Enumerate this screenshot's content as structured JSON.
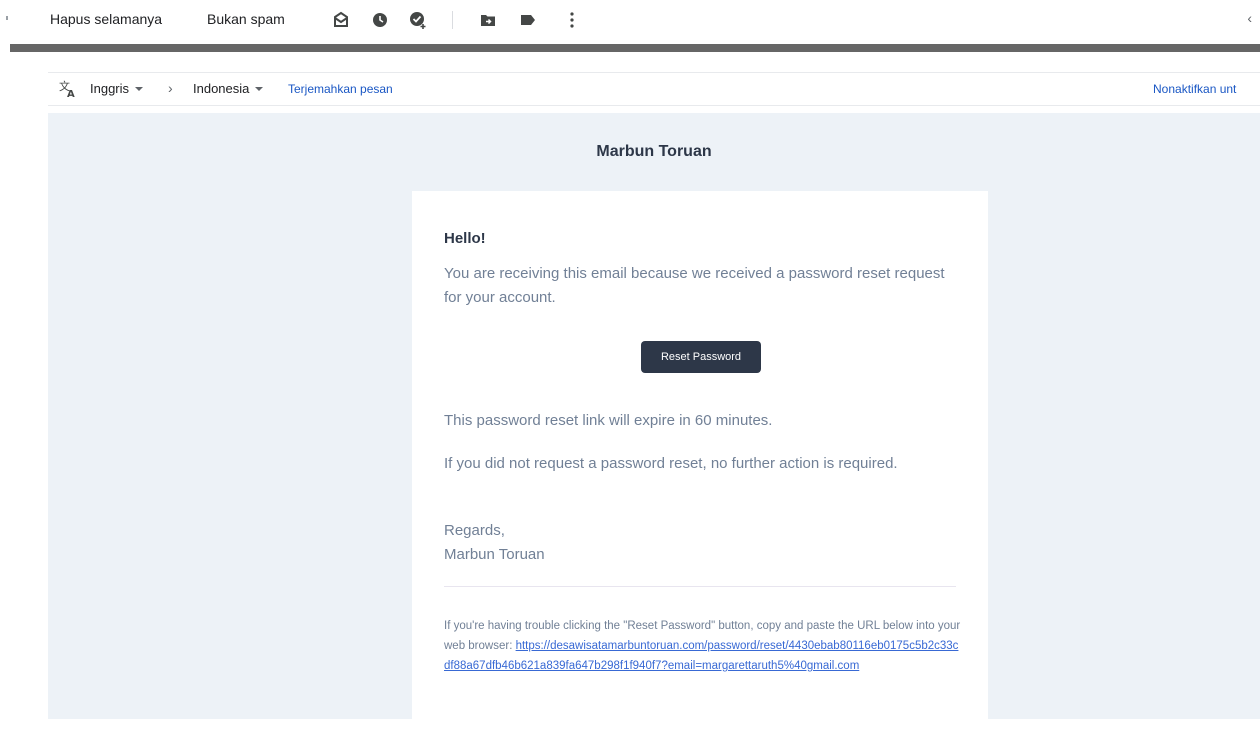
{
  "toolbar": {
    "delete_forever": "Hapus selamanya",
    "not_spam": "Bukan spam",
    "icons": [
      "mark-unread-icon",
      "snooze-icon",
      "add-to-tasks-icon",
      "move-to-icon",
      "label-icon",
      "more-options-icon"
    ]
  },
  "translate": {
    "from_lang": "Inggris",
    "to_lang": "Indonesia",
    "translate_link": "Terjemahkan pesan",
    "disable_link": "Nonaktifkan unt"
  },
  "email": {
    "sender_header": "Marbun Toruan",
    "greeting": "Hello!",
    "intro": "You are receiving this email because we received a password reset request for your account.",
    "button_label": "Reset Password",
    "expire_note": "This password reset link will expire in 60 minutes.",
    "no_action_note": "If you did not request a password reset, no further action is required.",
    "regards": "Regards,",
    "signature": "Marbun Toruan",
    "subcopy_text": "If you're having trouble clicking the \"Reset Password\" button, copy and paste the URL below into your web browser: ",
    "reset_url": "https://desawisatamarbuntoruan.com/password/reset/4430ebab80116eb0175c5b2c33cdf88a67dfb46b621a839fa647b298f1f940f7?email=margarettaruth5%40gmail.com"
  },
  "colors": {
    "button_bg": "#2d3748",
    "email_bg": "#edf2f7",
    "link": "#3869d4",
    "text_muted": "#718096"
  }
}
